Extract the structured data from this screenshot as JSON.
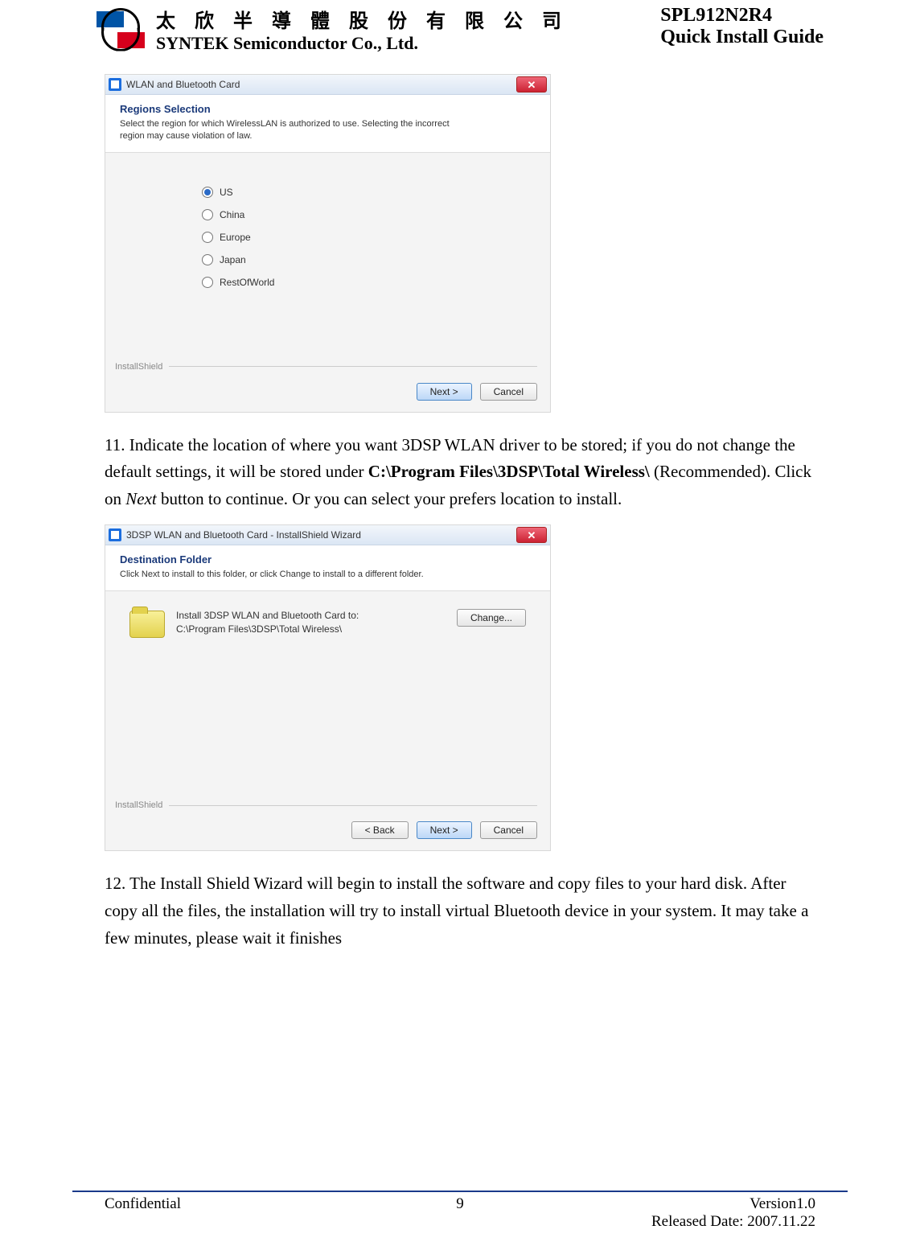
{
  "header": {
    "company_cn": "太 欣 半 導 體 股 份 有 限 公 司",
    "company_en": "SYNTEK Semiconductor Co., Ltd.",
    "model": "SPL912N2R4",
    "guide_title": "Quick Install Guide"
  },
  "screenshot1": {
    "window_title": "WLAN and Bluetooth Card",
    "banner_title": "Regions Selection",
    "banner_sub": "Select the region for which WirelessLAN is authorized to use. Selecting the incorrect region may cause violation of law.",
    "options": [
      "US",
      "China",
      "Europe",
      "Japan",
      "RestOfWorld"
    ],
    "selected_index": 0,
    "installshield_label": "InstallShield",
    "next_btn": "Next >",
    "cancel_btn": "Cancel",
    "close_glyph": "✕"
  },
  "step11": {
    "number": "11.",
    "text_a": " Indicate the location of where you want 3DSP WLAN driver to be stored; if you do not change the default settings, it will be stored under ",
    "bold_path": "C:\\Program Files\\3DSP\\Total Wireless\\",
    "text_b": " (Recommended). Click on ",
    "italic_next": "Next",
    "text_c": " button to continue. Or you can select your prefers location to install."
  },
  "screenshot2": {
    "window_title": "3DSP WLAN and Bluetooth Card - InstallShield Wizard",
    "banner_title": "Destination Folder",
    "banner_sub": "Click Next to install to this folder, or click Change to install to a different folder.",
    "dest_line1": "Install 3DSP WLAN and Bluetooth Card to:",
    "dest_line2": "C:\\Program Files\\3DSP\\Total Wireless\\",
    "change_btn": "Change...",
    "installshield_label": "InstallShield",
    "back_btn": "< Back",
    "next_btn": "Next >",
    "cancel_btn": "Cancel",
    "close_glyph": "✕"
  },
  "step12": {
    "number": "12.",
    "text": " The Install Shield Wizard will begin to install the software and copy files to your hard disk. After copy all the files, the installation will try to install virtual Bluetooth device in your system. It may take a few minutes, please wait it finishes"
  },
  "footer": {
    "left": "Confidential",
    "page_no": "9",
    "version": "Version1.0",
    "released": "Released Date: 2007.11.22"
  }
}
